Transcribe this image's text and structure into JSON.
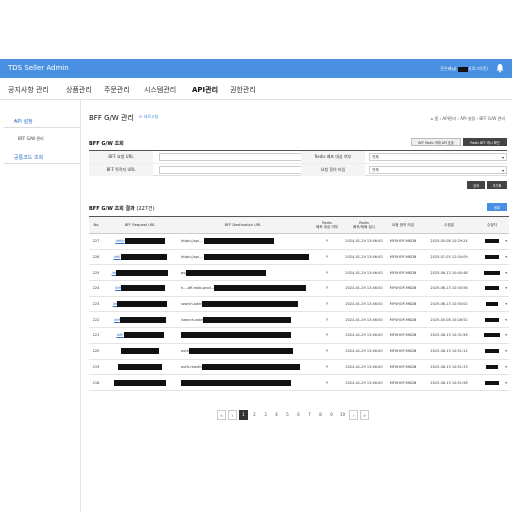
{
  "header": {
    "brand": "TDS Seller Admin",
    "user_prefix": "윤은혜님(",
    "user_suffix": ")(로그아웃)"
  },
  "nav": [
    "공지사항 관리",
    "상품관리",
    "주문관리",
    "시스템관리",
    "API관리",
    "권한관리"
  ],
  "sidebar": {
    "group1": "API 설정",
    "group1_toggle": "–",
    "sub1": "BFF G/W 관리",
    "group2": "공통코드 조회"
  },
  "page": {
    "title": "BFF G/W 관리",
    "refresh": "새로고침",
    "breadcrumb": "⌂ 홈 › API관리 › API 설정 › BFF G/W 관리"
  },
  "search": {
    "title": "BFF G/W 조회",
    "btn_redis_deploy": "BFF Redis 적재 API 호출",
    "btn_redis_view": "Redis BFF 캐시 확인",
    "label_bff_url": "BFF 요청 URL",
    "label_dest_url": "BFF 목적지 URL",
    "label_redis_target": "Redis 배포 대상 여부",
    "label_req_type": "요청 정의 타입",
    "select_redis": "전체",
    "select_type": "전체",
    "btn_search": "검색",
    "btn_reset": "초기화"
  },
  "results": {
    "title": "BFF G/W 조회 결과",
    "count": "(227건)",
    "btn_register": "등록",
    "columns": [
      "No",
      "BFF Request URL",
      "BFF Destination URL",
      "Redis\n배포 대상 여부",
      "Redis\n배포/재배 일시",
      "요청 정의 타입",
      "수정일",
      "수정자"
    ],
    "rows": [
      {
        "no": "227",
        "url_prefix": "/bff/p",
        "dest_prefix": "https://api-...",
        "redis": "Y",
        "deploy": "2024-01-29 13:46:00",
        "type": "MYSHOP-MKDB",
        "modified": "2025-05-08 10:29:24"
      },
      {
        "no": "226",
        "url_prefix": "/bff/",
        "dest_prefix": "https://api-...",
        "redis": "Y",
        "deploy": "2024-01-29 13:46:00",
        "type": "MYSHOP-MKDB",
        "modified": "2025-07-03 12:04:09"
      },
      {
        "no": "225",
        "url_prefix": "/bf",
        "dest_prefix": "ps/",
        "redis": "Y",
        "deploy": "2024-01-29 13:46:00",
        "type": "MYSHOP-MKDB",
        "modified": "2025-06-13 10:40:48"
      },
      {
        "no": "224",
        "url_prefix": "/bff",
        "dest_prefix": "h...-bff-mbb-prod...",
        "redis": "Y",
        "deploy": "2024-01-29 13:46:00",
        "type": "MYSHOP-MKDB",
        "modified": "2025-06-13 10:30:56"
      },
      {
        "no": "223",
        "url_prefix": "/bf",
        "dest_prefix": "search-addr",
        "redis": "Y",
        "deploy": "2024-01-29 13:46:00",
        "type": "MYSHOP-MKDB",
        "modified": "2025-06-13 10:30:02"
      },
      {
        "no": "222",
        "url_prefix": "/bff",
        "dest_prefix": "/search-addr",
        "redis": "Y",
        "deploy": "2024-01-29 13:46:00",
        "type": "MYSHOP-MKDB",
        "modified": "2025-05-08 10:28:52"
      },
      {
        "no": "221",
        "url_prefix": "/bff/",
        "dest_prefix": "",
        "redis": "Y",
        "deploy": "2024-01-29 13:46:00",
        "type": "MYSHOP-MKDB",
        "modified": "2025-06-13 10:31:56"
      },
      {
        "no": "220",
        "url_prefix": "",
        "dest_prefix": "auth",
        "redis": "Y",
        "deploy": "2024-01-29 13:46:00",
        "type": "MYSHOP-MKDB",
        "modified": "2025-06-13 10:51:12"
      },
      {
        "no": "219",
        "url_prefix": "",
        "dest_prefix": "auth-reauth",
        "redis": "Y",
        "deploy": "2024-01-29 13:46:00",
        "type": "MYSHOP-MKDB",
        "modified": "2025-06-13 10:51:33"
      },
      {
        "no": "218",
        "url_prefix": "",
        "dest_prefix": "",
        "redis": "Y",
        "deploy": "2024-01-29 13:46:00",
        "type": "MYSHOP-MKDB",
        "modified": "2025-06-13 10:51:58"
      }
    ]
  },
  "pager": {
    "first": "«",
    "prev": "‹",
    "pages": [
      "1",
      "2",
      "3",
      "4",
      "5",
      "6",
      "7",
      "8",
      "9",
      "10"
    ],
    "next": "›",
    "last": "»",
    "current": "1"
  }
}
